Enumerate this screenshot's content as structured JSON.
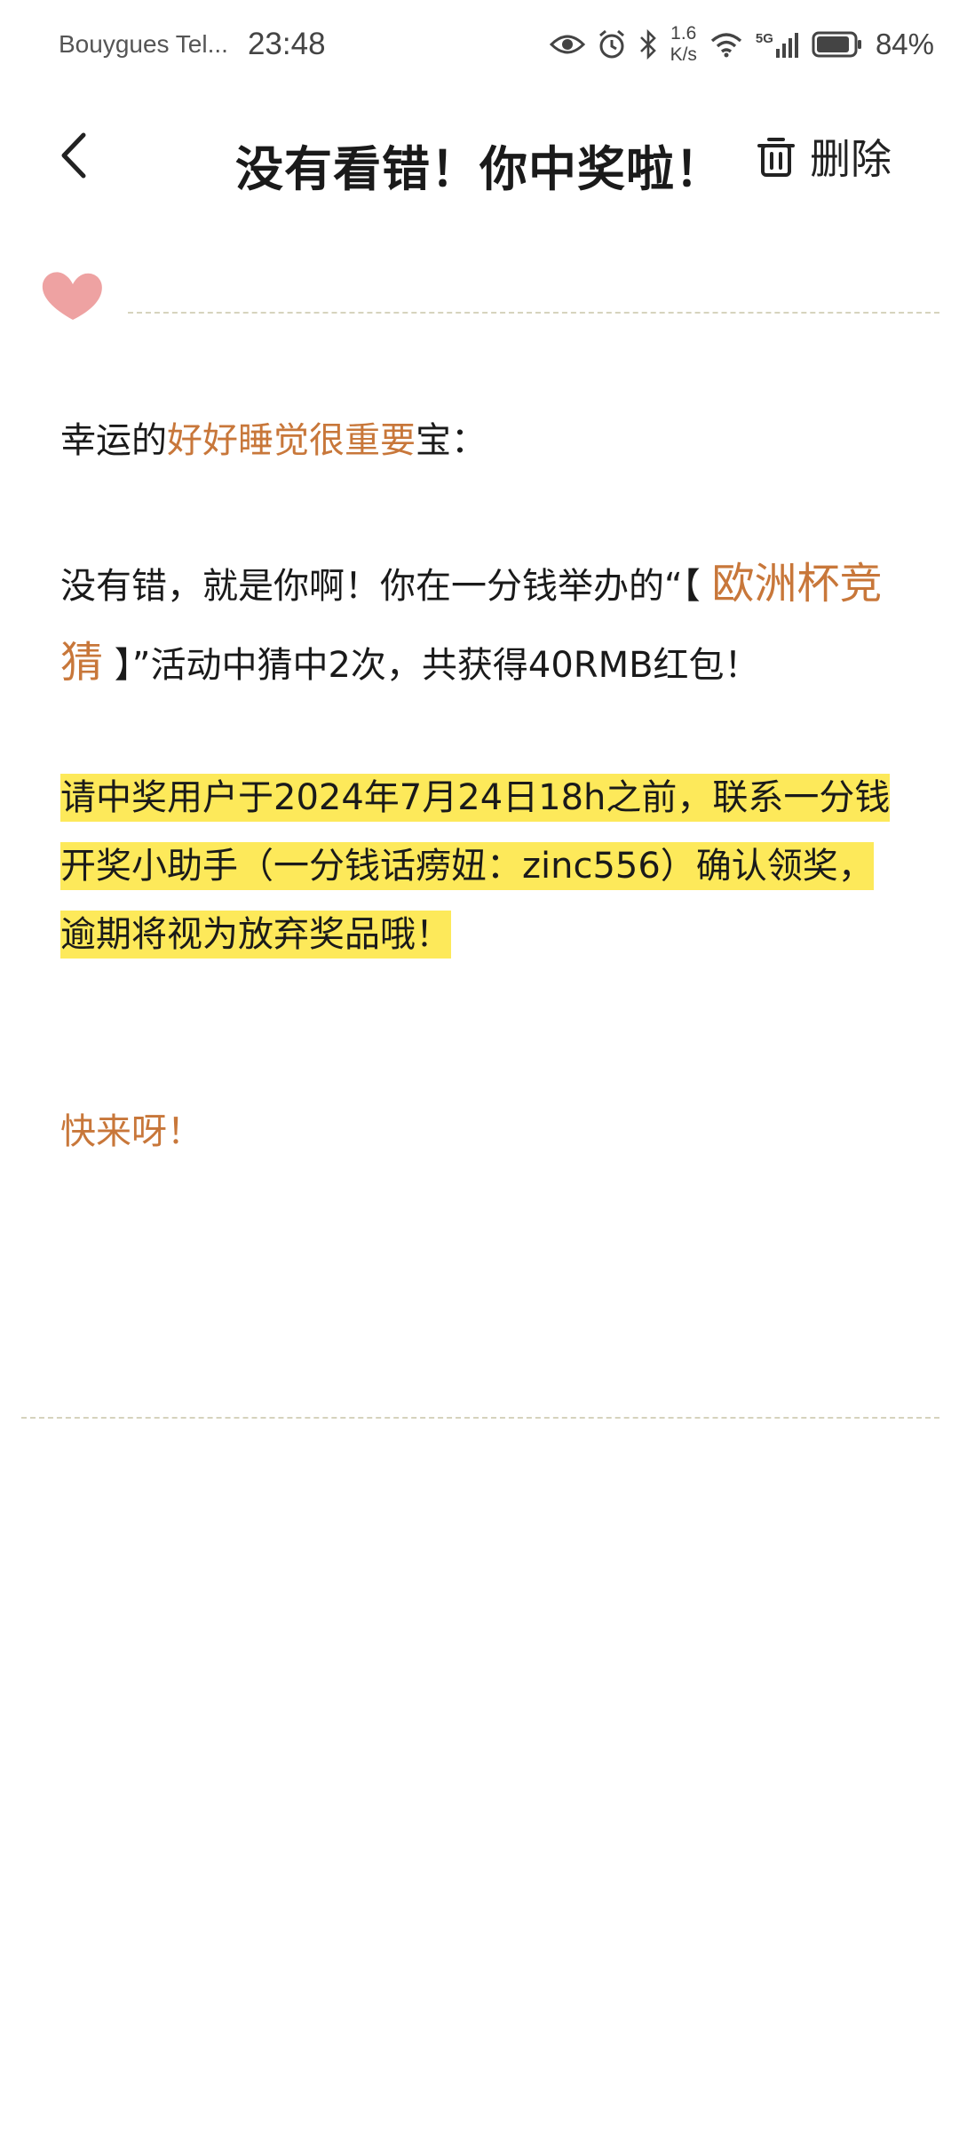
{
  "status_bar": {
    "carrier": "Bouygues Tel...",
    "time": "23:48",
    "speed_value": "1.6",
    "speed_unit": "K/s",
    "network": "5G",
    "battery": "84%"
  },
  "header": {
    "title": "没有看错！你中奖啦！",
    "delete_label": "删除"
  },
  "message": {
    "greeting_prefix": "幸运的",
    "nickname": "好好睡觉很重要",
    "greeting_suffix": "宝：",
    "para1_prefix": "没有错，就是你啊！你在一分钱举办的“【 ",
    "event_name": "欧洲杯竞猜",
    "para1_suffix": " 】”活动中猜中2次，共获得40RMB红包！",
    "notice": "请中奖用户于2024年7月24日18h之前，联系一分钱开奖小助手（一分钱话痨妞：zinc556）确认领奖，逾期将视为放弃奖品哦！",
    "closing": "快来呀！"
  },
  "colors": {
    "accent": "#c8773a",
    "highlight": "#fde95a",
    "heart": "#eea2a2"
  }
}
